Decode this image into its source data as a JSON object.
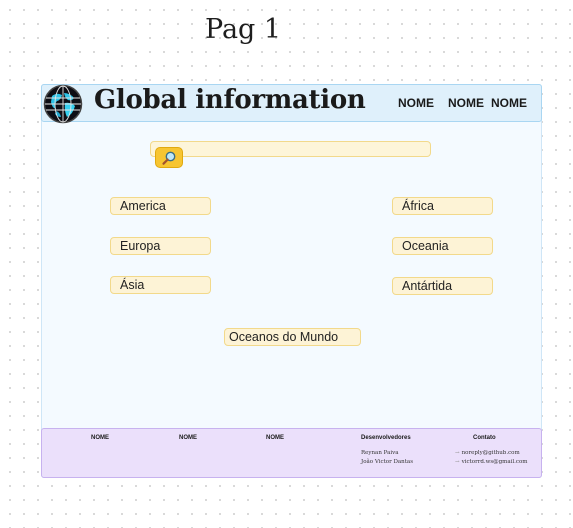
{
  "page_label": "Pag 1",
  "header": {
    "title": "Global information",
    "nav": [
      "NOME",
      "NOME",
      "NOME"
    ]
  },
  "search": {
    "value": "",
    "icon": "magnifier-icon"
  },
  "continents": {
    "left": [
      "America",
      "Europa",
      "Ásia"
    ],
    "right": [
      "África",
      "Oceania",
      "Antártida"
    ],
    "oceans": "Oceanos do Mundo"
  },
  "footer": {
    "links": [
      "NOME",
      "NOME",
      "NOME"
    ],
    "dev_heading": "Desenvolvedores",
    "devs": [
      "Reynan Paiva",
      "João Victor Dantas"
    ],
    "contact_heading": "Contato",
    "contacts": [
      "noreply@github.com",
      "victorrd.ws@gmail.com"
    ]
  },
  "colors": {
    "header_bg": "#dff0fb",
    "pill_bg": "#fdf3d6",
    "search_button": "#f7c531",
    "footer_bg": "#ebe0fb"
  }
}
